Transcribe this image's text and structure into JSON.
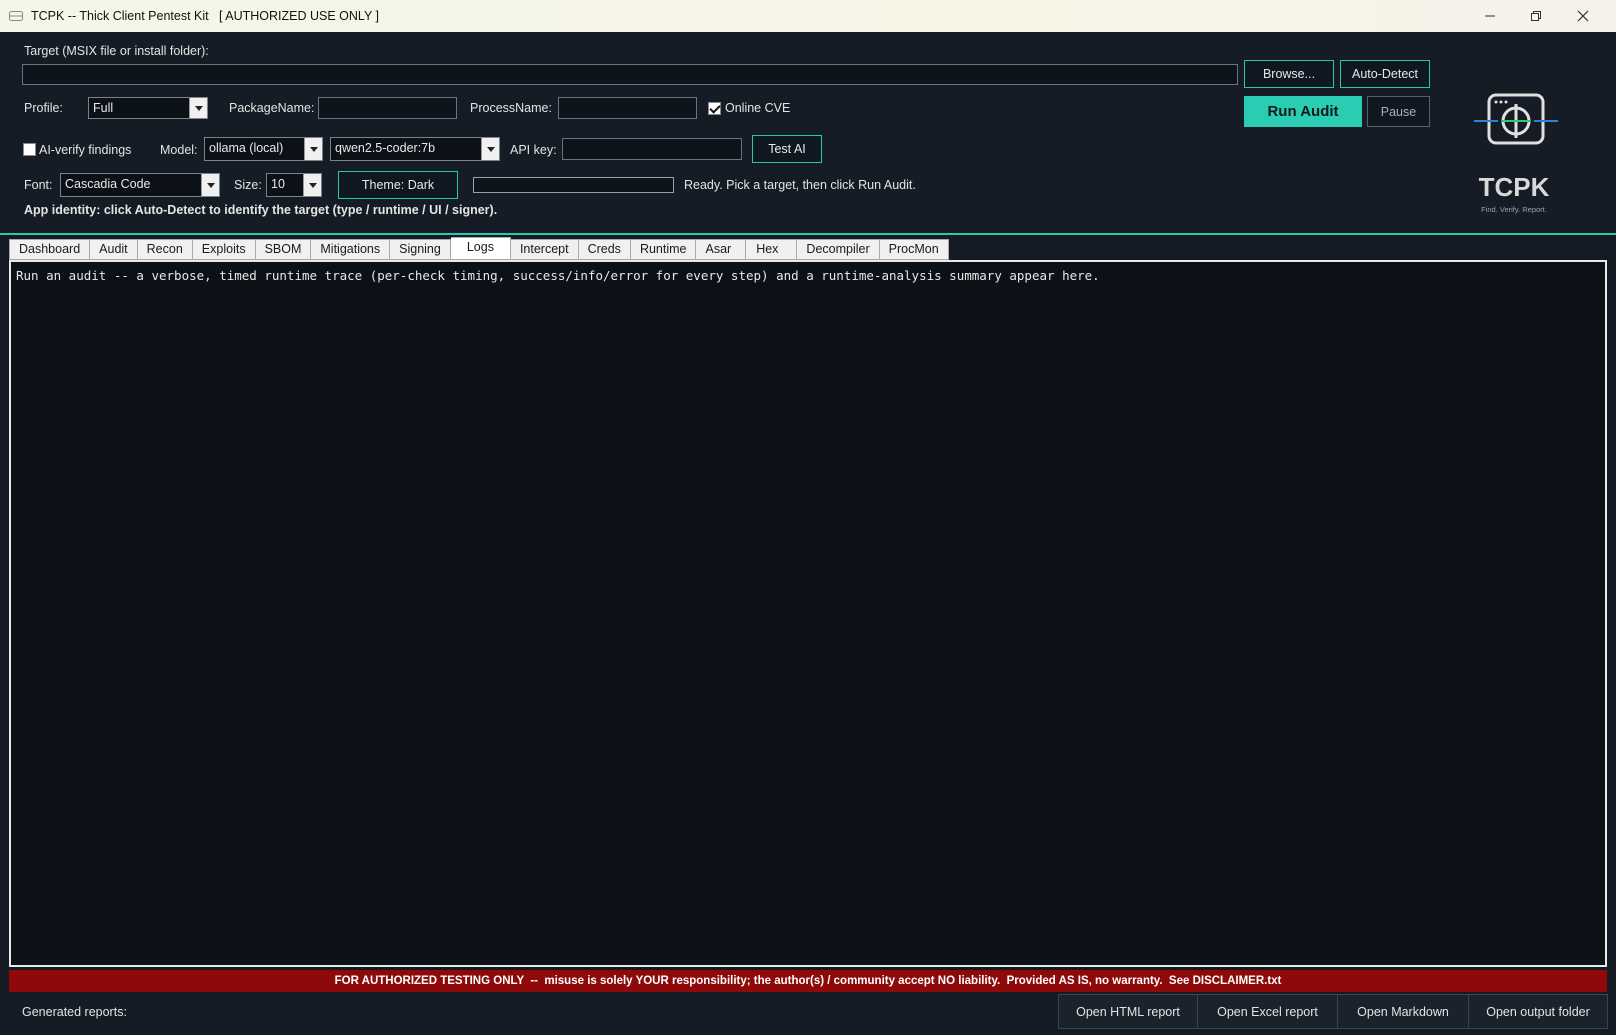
{
  "window": {
    "title": "TCPK -- Thick Client Pentest Kit   [ AUTHORIZED USE ONLY ]",
    "controls": [
      "minimize-icon",
      "restore-icon",
      "close-icon"
    ]
  },
  "target": {
    "label": "Target (MSIX file or install folder):",
    "value": "",
    "browse_label": "Browse...",
    "autodetect_label": "Auto-Detect"
  },
  "profile": {
    "label": "Profile:",
    "selected": "Full",
    "package_label": "PackageName:",
    "package_value": "",
    "process_label": "ProcessName:",
    "process_value": "",
    "online_cve_label": "Online CVE",
    "online_cve_checked": true
  },
  "run": {
    "run_label": "Run Audit",
    "pause_label": "Pause"
  },
  "ai": {
    "verify_label": "AI-verify findings",
    "verify_checked": false,
    "model_label": "Model:",
    "model_selected": "ollama (local)",
    "model_name": "qwen2.5-coder:7b",
    "apikey_label": "API key:",
    "apikey_value": "",
    "test_label": "Test AI"
  },
  "appearance": {
    "font_label": "Font:",
    "font_selected": "Cascadia Code",
    "size_label": "Size:",
    "size_selected": "10",
    "theme_label": "Theme: Dark",
    "progress": 0,
    "status": "Ready. Pick a target, then click Run Audit."
  },
  "identity_text": "App identity: click Auto-Detect to identify the target (type / runtime / UI / signer).",
  "logo": {
    "brand": "TCPK",
    "tagline": "Find. Verify. Report.",
    "icon": "target-window-icon"
  },
  "tabs": [
    {
      "label": "Dashboard"
    },
    {
      "label": "Audit"
    },
    {
      "label": "Recon"
    },
    {
      "label": "Exploits"
    },
    {
      "label": "SBOM"
    },
    {
      "label": "Mitigations"
    },
    {
      "label": "Signing"
    },
    {
      "label": "Logs"
    },
    {
      "label": "Intercept"
    },
    {
      "label": "Creds"
    },
    {
      "label": "Runtime"
    },
    {
      "label": "Asar"
    },
    {
      "label": "Hex"
    },
    {
      "label": "Decompiler"
    },
    {
      "label": "ProcMon"
    }
  ],
  "active_tab": "Logs",
  "log_text": "Run an audit -- a verbose, timed runtime trace (per-check timing, success/info/error for every step) and a runtime-analysis summary appear here.",
  "disclaimer": "FOR AUTHORIZED TESTING ONLY  --  misuse is solely YOUR responsibility; the author(s) / community accept NO liability.  Provided AS IS, no warranty.  See DISCLAIMER.txt",
  "bottom": {
    "generated_label": "Generated reports:",
    "buttons": [
      "Open HTML report",
      "Open Excel report",
      "Open Markdown",
      "Open output folder"
    ]
  },
  "colors": {
    "accent": "#2bcdb2",
    "background": "#141b24",
    "log_bg": "#0c1117",
    "disclaimer_bg": "#8e0a0a"
  }
}
